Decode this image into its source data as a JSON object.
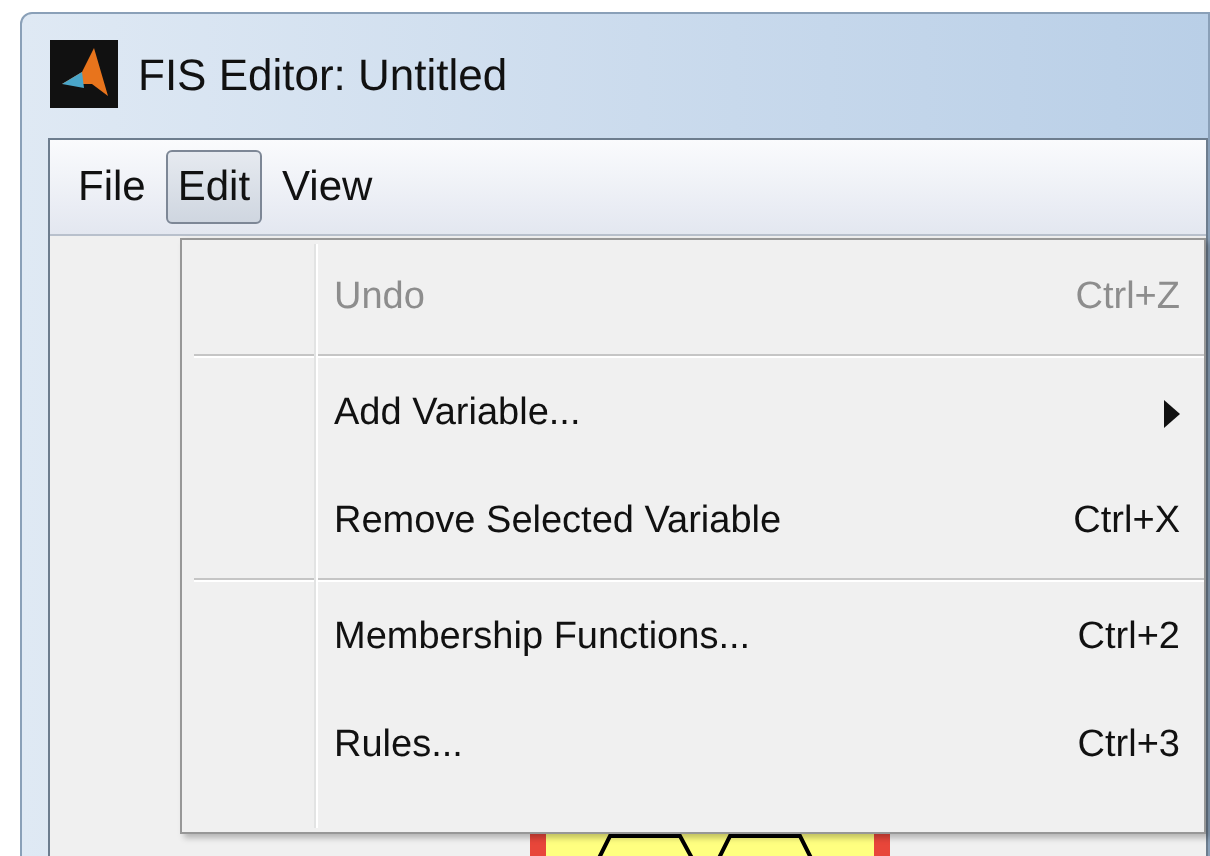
{
  "window": {
    "title": "FIS Editor: Untitled"
  },
  "menubar": [
    {
      "label": "File",
      "selected": false
    },
    {
      "label": "Edit",
      "selected": true
    },
    {
      "label": "View",
      "selected": false
    }
  ],
  "menu": {
    "groups": [
      [
        {
          "label": "Undo",
          "shortcut": "Ctrl+Z",
          "disabled": true,
          "submenu": false
        }
      ],
      [
        {
          "label": "Add Variable...",
          "disabled": false,
          "submenu": true
        },
        {
          "label": "Remove Selected Variable",
          "shortcut": "Ctrl+X",
          "disabled": false,
          "submenu": false
        }
      ],
      [
        {
          "label": "Membership Functions...",
          "shortcut": "Ctrl+2",
          "disabled": false,
          "submenu": false
        },
        {
          "label": "Rules...",
          "shortcut": "Ctrl+3",
          "disabled": false,
          "submenu": false
        }
      ]
    ]
  }
}
